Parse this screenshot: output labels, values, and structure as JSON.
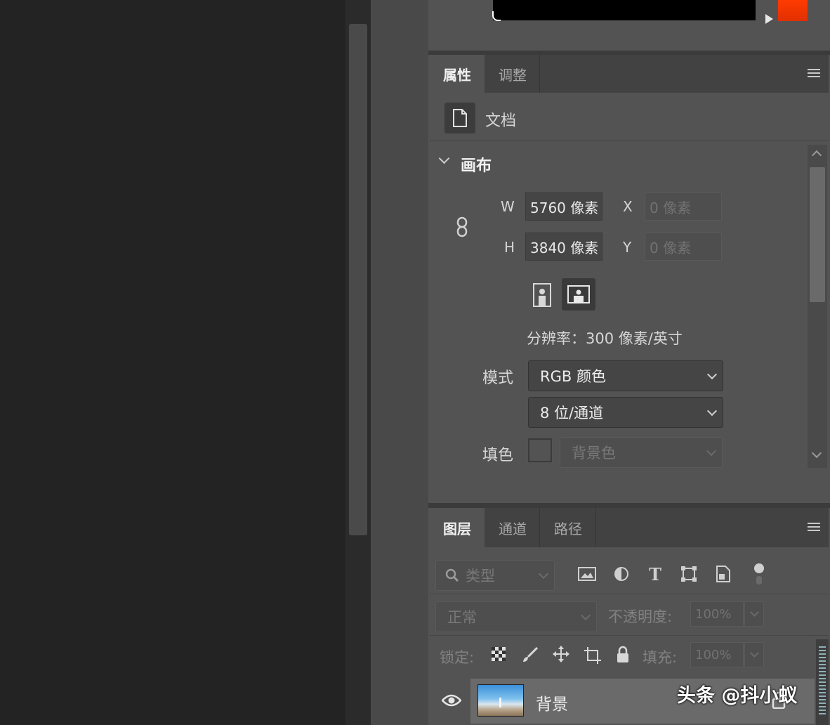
{
  "properties_panel": {
    "tabs": [
      {
        "label": "属性"
      },
      {
        "label": "调整"
      }
    ],
    "doc_label": "文档",
    "canvas_section": {
      "title": "画布",
      "w_label": "W",
      "w_value": "5760 像素",
      "h_label": "H",
      "h_value": "3840 像素",
      "x_label": "X",
      "x_value": "0 像素",
      "y_label": "Y",
      "y_value": "0 像素",
      "resolution": "分辨率：300 像素/英寸",
      "mode_label": "模式",
      "mode_value": "RGB 颜色",
      "depth_value": "8 位/通道",
      "fill_label": "填色",
      "fill_value": "背景色"
    }
  },
  "layers_panel": {
    "tabs": [
      {
        "label": "图层"
      },
      {
        "label": "通道"
      },
      {
        "label": "路径"
      }
    ],
    "filter_placeholder": "类型",
    "blend_mode": "正常",
    "opacity_label": "不透明度:",
    "opacity_value": "100%",
    "lock_label": "锁定:",
    "fill_label": "填充:",
    "fill_value": "100%",
    "layer_name": "背景"
  },
  "watermark": "头条 @抖小蚁",
  "colors": {
    "panel": "#535353",
    "tabbar": "#424242",
    "canvas": "#232323",
    "accent_swatch": "#ff3b00"
  }
}
